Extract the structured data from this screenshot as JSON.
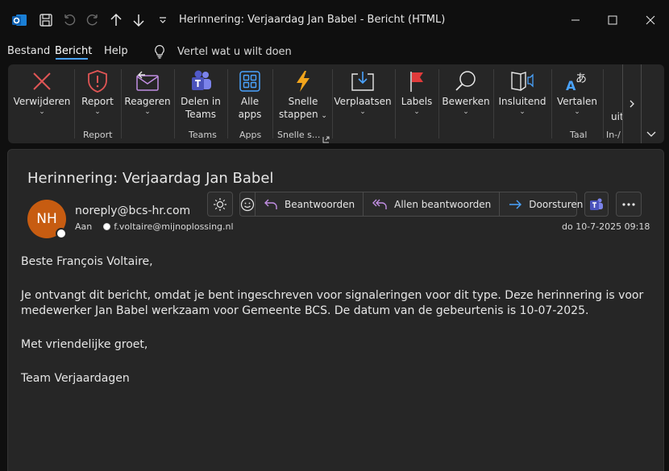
{
  "window": {
    "title": "Herinnering: Verjaardag Jan Babel  -  Bericht (HTML)"
  },
  "menu": {
    "items": [
      "Bestand",
      "Bericht",
      "Help"
    ],
    "active": "Bericht",
    "tell_me": "Vertel wat u wilt doen"
  },
  "ribbon": {
    "buttons": {
      "delete": "Verwijderen",
      "report": "Report",
      "reply": "Reageren",
      "teams_line1": "Delen in",
      "teams_line2": "Teams",
      "apps_line1": "Alle",
      "apps_line2": "apps",
      "quick_line1": "Snelle",
      "quick_line2": "stappen",
      "move": "Verplaatsen",
      "labels": "Labels",
      "edit": "Bewerken",
      "immersive": "Insluitend",
      "translate": "Vertalen",
      "cutoff": "uit"
    },
    "groups": {
      "report": "Report",
      "teams": "Teams",
      "apps": "Apps",
      "quick": "Snelle s...",
      "language": "Taal",
      "addins": "In-/"
    }
  },
  "message": {
    "subject": "Herinnering: Verjaardag Jan Babel",
    "avatar_initials": "NH",
    "sender": "noreply@bcs-hr.com",
    "to_label": "Aan",
    "recipient": "f.voltaire@mijnoplossing.nl",
    "date": "do 10-7-2025 09:18",
    "actions": {
      "reply": "Beantwoorden",
      "reply_all": "Allen beantwoorden",
      "forward": "Doorsturen"
    },
    "body": [
      "Beste François Voltaire,",
      "Je ontvangt dit bericht, omdat je bent ingeschreven voor signaleringen voor dit type. Deze herinnering is voor medewerker Jan Babel werkzaam voor Gemeente BCS. De datum van de gebeurtenis is 10-07-2025.",
      "Met vriendelijke groet,",
      "Team Verjaardagen"
    ]
  },
  "colors": {
    "background": "#0f0f0f",
    "panel": "#262626",
    "accent": "#4aa3ff",
    "avatar": "#c75c11",
    "reply_icon": "#c18ee3",
    "forward_icon": "#4aa3ff",
    "delete_icon": "#e05555",
    "flag": "#e03b3b"
  },
  "icons": [
    "outlook-icon",
    "save-icon",
    "undo-icon",
    "redo-icon",
    "arrow-up-icon",
    "arrow-down-icon",
    "customize-icon",
    "minimize-icon",
    "maximize-icon",
    "close-icon",
    "lightbulb-icon",
    "delete-icon",
    "report-shield-icon",
    "reply-envelope-icon",
    "teams-icon",
    "apps-grid-icon",
    "lightning-icon",
    "move-icon",
    "flag-icon",
    "search-icon",
    "immersive-reader-icon",
    "translate-icon",
    "chevron-right-icon",
    "chevron-down-icon",
    "brightness-icon",
    "emoji-icon",
    "reply-icon",
    "reply-all-icon",
    "forward-icon",
    "more-icon"
  ]
}
